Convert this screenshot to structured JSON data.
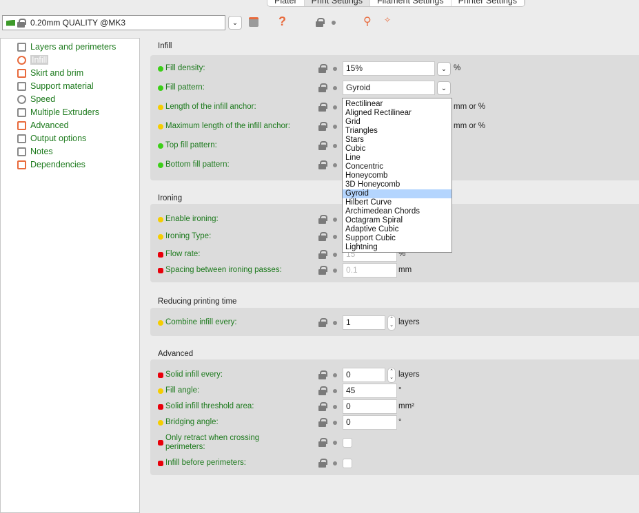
{
  "tabs": [
    "Plater",
    "Print Settings",
    "Filament Settings",
    "Printer Settings"
  ],
  "selected_tab": "Print Settings",
  "preset": {
    "name": "0.20mm QUALITY @MK3",
    "flag_color": "#3d9a2a"
  },
  "sidebar": {
    "items": [
      {
        "label": "Layers and perimeters",
        "icon": "layers-icon"
      },
      {
        "label": "Infill",
        "icon": "infill-icon",
        "selected": true
      },
      {
        "label": "Skirt and brim",
        "icon": "skirt-icon"
      },
      {
        "label": "Support material",
        "icon": "support-icon"
      },
      {
        "label": "Speed",
        "icon": "speed-icon"
      },
      {
        "label": "Multiple Extruders",
        "icon": "extruder-icon"
      },
      {
        "label": "Advanced",
        "icon": "advanced-gear-icon"
      },
      {
        "label": "Output options",
        "icon": "output-icon"
      },
      {
        "label": "Notes",
        "icon": "notes-icon"
      },
      {
        "label": "Dependencies",
        "icon": "dependencies-gear-icon"
      }
    ]
  },
  "colors": {
    "simple": "#3ccf18",
    "advanced": "#f5cd00",
    "expert": "#e8000a",
    "label": "#1d7a1d"
  },
  "sections": [
    {
      "title": "Infill",
      "rows": [
        {
          "label": "Fill density:",
          "mode": "simple",
          "value": "15%",
          "control": "combo",
          "unit": "%"
        },
        {
          "label": "Fill pattern:",
          "mode": "simple",
          "value": "Gyroid",
          "control": "select"
        },
        {
          "label": "Length of the infill anchor:",
          "mode": "advanced",
          "unit": "mm or %"
        },
        {
          "label": "Maximum length of the infill anchor:",
          "mode": "advanced",
          "unit": "mm or %"
        },
        {
          "label": "Top fill pattern:",
          "mode": "simple"
        },
        {
          "label": "Bottom fill pattern:",
          "mode": "simple"
        }
      ]
    },
    {
      "title": "Ironing",
      "rows": [
        {
          "label": "Enable ironing:",
          "mode": "advanced"
        },
        {
          "label": "Ironing Type:",
          "mode": "advanced"
        },
        {
          "label": "Flow rate:",
          "mode": "expert",
          "value": "15",
          "control": "text",
          "disabled": true,
          "unit": "%"
        },
        {
          "label": "Spacing between ironing passes:",
          "mode": "expert",
          "value": "0.1",
          "control": "text",
          "disabled": true,
          "unit": "mm"
        }
      ]
    },
    {
      "title": "Reducing printing time",
      "rows": [
        {
          "label": "Combine infill every:",
          "mode": "advanced",
          "value": "1",
          "control": "spin",
          "unit": "layers"
        }
      ]
    },
    {
      "title": "Advanced",
      "rows": [
        {
          "label": "Solid infill every:",
          "mode": "expert",
          "value": "0",
          "control": "spin",
          "unit": "layers"
        },
        {
          "label": "Fill angle:",
          "mode": "advanced",
          "value": "45",
          "control": "text",
          "unit": "°"
        },
        {
          "label": "Solid infill threshold area:",
          "mode": "expert",
          "value": "0",
          "control": "text",
          "unit": "mm²"
        },
        {
          "label": "Bridging angle:",
          "mode": "advanced",
          "value": "0",
          "control": "text",
          "unit": "°"
        },
        {
          "label": "Only retract when crossing perimeters:",
          "mode": "expert",
          "control": "checkbox",
          "checked": false
        },
        {
          "label": "Infill before perimeters:",
          "mode": "expert",
          "control": "checkbox",
          "checked": false
        }
      ]
    }
  ],
  "fill_pattern_options": [
    "Rectilinear",
    "Aligned Rectilinear",
    "Grid",
    "Triangles",
    "Stars",
    "Cubic",
    "Line",
    "Concentric",
    "Honeycomb",
    "3D Honeycomb",
    "Gyroid",
    "Hilbert Curve",
    "Archimedean Chords",
    "Octagram Spiral",
    "Adaptive Cubic",
    "Support Cubic",
    "Lightning"
  ],
  "fill_pattern_highlighted": "Gyroid"
}
